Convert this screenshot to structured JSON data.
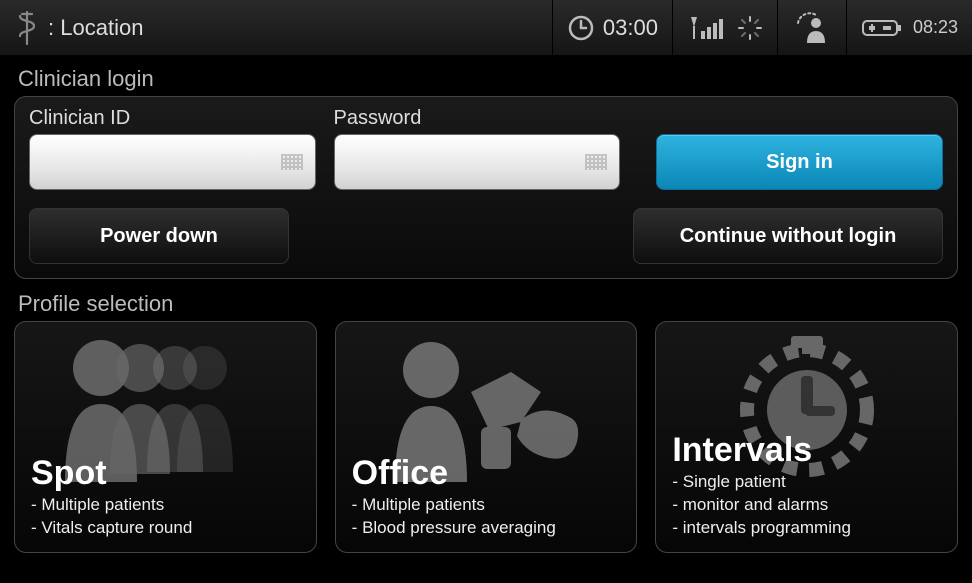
{
  "statusbar": {
    "location_prefix": ":",
    "location": "Location",
    "timer": "03:00",
    "clock": "08:23"
  },
  "login": {
    "section_label": "Clinician login",
    "clinician_id_label": "Clinician ID",
    "clinician_id_value": "",
    "password_label": "Password",
    "password_value": "",
    "signin_label": "Sign in",
    "powerdown_label": "Power down",
    "continue_label": "Continue without login"
  },
  "profiles": {
    "section_label": "Profile selection",
    "cards": [
      {
        "title": "Spot",
        "bullets": [
          "Multiple patients",
          "Vitals capture round"
        ]
      },
      {
        "title": "Office",
        "bullets": [
          "Multiple patients",
          "Blood pressure averaging"
        ]
      },
      {
        "title": "Intervals",
        "bullets": [
          "Single patient",
          "monitor and alarms",
          "intervals programming"
        ]
      }
    ]
  }
}
